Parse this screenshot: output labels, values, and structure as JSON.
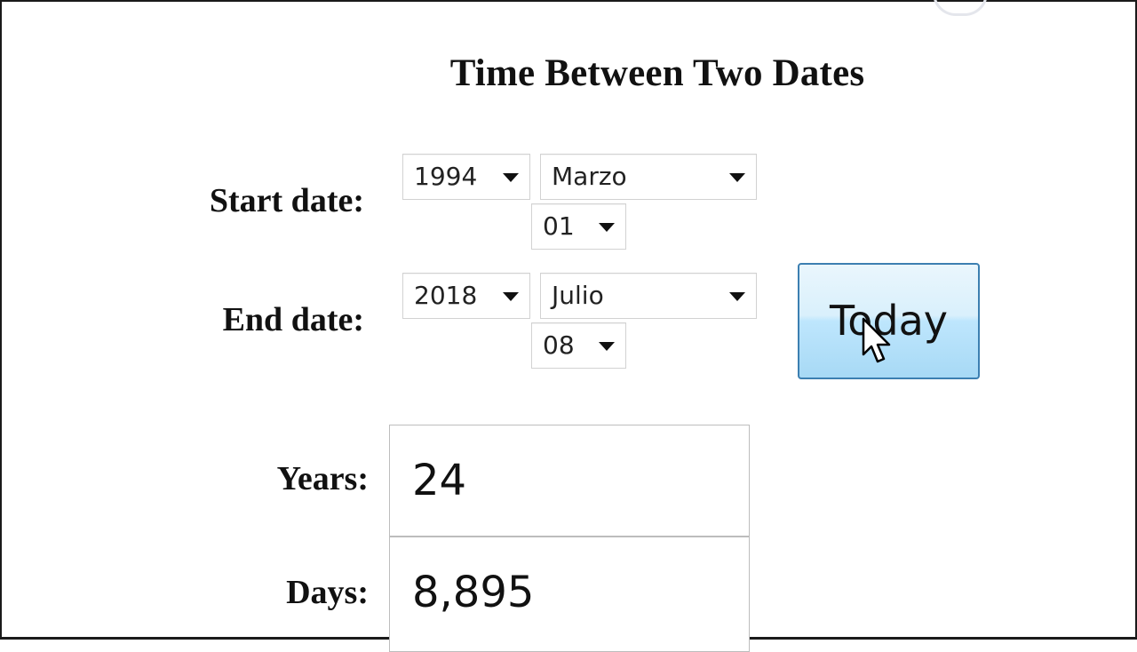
{
  "page": {
    "title": "Time Between Two Dates"
  },
  "start_date": {
    "label": "Start date:",
    "year": "1994",
    "month": "Marzo",
    "day": "01"
  },
  "end_date": {
    "label": "End date:",
    "year": "2018",
    "month": "Julio",
    "day": "08"
  },
  "today_button": {
    "label": "Today"
  },
  "results": {
    "years_label": "Years:",
    "years_value": "24",
    "days_label": "Days:",
    "days_value": "8,895"
  },
  "icons": {
    "dropdown": "chevron-down-icon",
    "cursor": "mouse-pointer-icon"
  },
  "colors": {
    "button_border": "#3c7fb1",
    "button_fill_top": "#eaf6fd",
    "button_fill_bottom": "#a7d9f5",
    "text": "#111111"
  }
}
